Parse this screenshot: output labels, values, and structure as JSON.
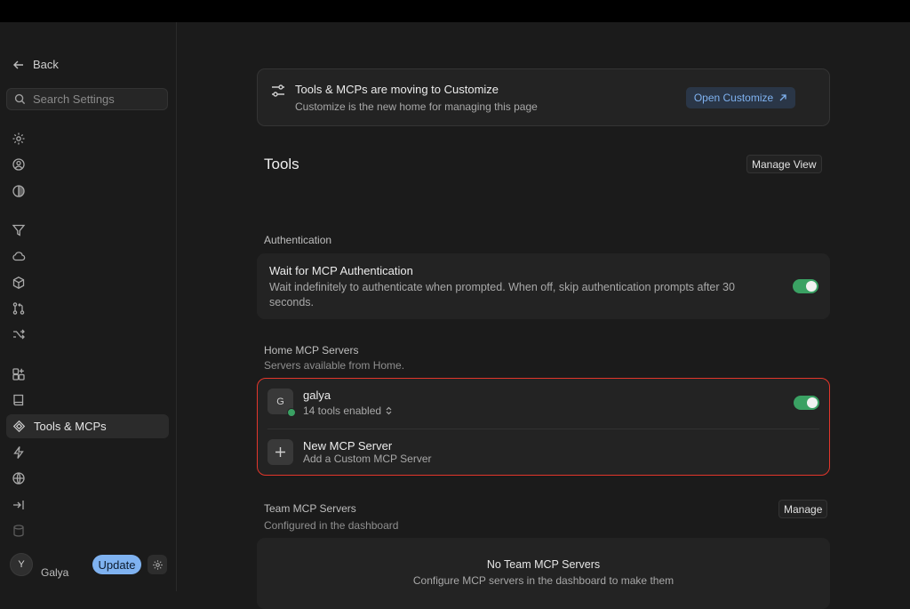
{
  "sidebar": {
    "back_label": "Back",
    "search_placeholder": "Search Settings",
    "active_item": "Tools & MCPs",
    "icons": [
      "gear-icon",
      "user-circle-icon",
      "contrast-icon",
      "filter-icon",
      "cloud-icon",
      "box-icon",
      "git-pull-request-icon",
      "shuffle-icon",
      "grid-plus-icon",
      "book-icon",
      "tools-mcp-icon",
      "lightning-icon",
      "globe-icon",
      "arrow-to-line-icon",
      "database-icon"
    ],
    "user": {
      "initial": "Y",
      "name": "Galya"
    },
    "update_label": "Update"
  },
  "banner": {
    "title": "Tools & MCPs are moving to Customize",
    "subtitle": "Customize is the new home for managing this page",
    "button_label": "Open Customize",
    "button_icon": "arrow-up-right-icon"
  },
  "tools": {
    "title": "Tools",
    "manage_view_label": "Manage View"
  },
  "authentication": {
    "section_label": "Authentication",
    "title": "Wait for MCP Authentication",
    "description": "Wait indefinitely to authenticate when prompted. When off, skip authentication prompts after 30 seconds.",
    "enabled": true
  },
  "home_servers": {
    "section_label": "Home MCP Servers",
    "section_sub": "Servers available from Home.",
    "servers": [
      {
        "initial": "G",
        "name": "galya",
        "tools_label": "14 tools enabled",
        "enabled": true,
        "status": "online"
      }
    ],
    "new_server": {
      "title": "New MCP Server",
      "subtitle": "Add a Custom MCP Server"
    }
  },
  "team_servers": {
    "section_label": "Team MCP Servers",
    "section_sub": "Configured in the dashboard",
    "manage_label": "Manage",
    "empty_title": "No Team MCP Servers",
    "empty_desc": "Configure MCP servers in the dashboard to make them"
  },
  "colors": {
    "accent_blue": "#7fb2f0",
    "toggle_green": "#3aa163",
    "highlight_red": "#e2362b"
  }
}
